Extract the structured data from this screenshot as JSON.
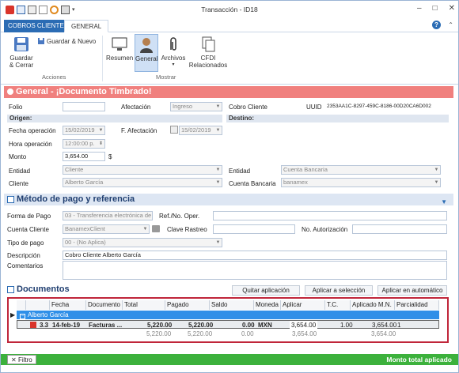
{
  "window": {
    "title": "Transacción - ID18"
  },
  "tabs": {
    "active_tab": "COBROS CLIENTE",
    "general_tab": "GENERAL"
  },
  "ribbon": {
    "guardar_cerrar": "Guardar\n& Cerrar",
    "guardar_nuevo": "Guardar & Nuevo",
    "acciones_group": "Acciones",
    "resumen": "Resumen",
    "general": "General",
    "archivos": "Archivos",
    "cfdi": "CFDI\nRelacionados",
    "mostrar_group": "Mostrar"
  },
  "header": {
    "status_title": "General - ¡Documento Timbrado!"
  },
  "general": {
    "folio_label": "Folio",
    "folio_value": "",
    "afectacion_label": "Afectación",
    "afectacion_value": "Ingreso",
    "cobro_cliente_label": "Cobro Cliente",
    "uuid_label": "UUID",
    "uuid_value": "2353AA1C-8297-459C-8186-00D20CA6D002",
    "origen_label": "Origen:",
    "destino_label": "Destino:",
    "fecha_operacion_label": "Fecha operación",
    "fecha_operacion_value": "15/02/2019",
    "f_afectacion_label": "F. Afectación",
    "f_afectacion_value": "15/02/2019",
    "hora_operacion_label": "Hora operación",
    "hora_operacion_value": "12:00:00 p.",
    "monto_label": "Monto",
    "monto_value": "3,654.00",
    "monto_currency": "$",
    "entidad_label": "Entidad",
    "entidad_value": "Cliente",
    "cliente_label": "Cliente",
    "cliente_value": "Alberto García",
    "entidad_dest_label": "Entidad",
    "entidad_dest_value": "Cuenta Bancaria",
    "cuenta_bancaria_label": "Cuenta Bancaria",
    "cuenta_bancaria_value": "banamex"
  },
  "pago": {
    "section_title": "Método de pago y referencia",
    "forma_pago_label": "Forma de Pago",
    "forma_pago_value": "03 - Transferencia electrónica de",
    "ref_label": "Ref./No. Oper.",
    "ref_value": "",
    "cuenta_cliente_label": "Cuenta Cliente",
    "cuenta_cliente_value": "BanamexClient",
    "clave_rastreo_label": "Clave Rastreo",
    "clave_rastreo_value": "",
    "no_autorizacion_label": "No. Autorización",
    "no_autorizacion_value": "",
    "tipo_pago_label": "Tipo de pago",
    "tipo_pago_value": "00 - (No Aplica)",
    "descripcion_label": "Descripción",
    "descripcion_value": "Cobro Cliente Alberto García",
    "comentarios_label": "Comentarios",
    "comentarios_value": ""
  },
  "documentos": {
    "section_title": "Documentos",
    "quitar": "Quitar aplicación",
    "aplicar_sel": "Aplicar a selección",
    "aplicar_auto": "Aplicar en automático",
    "columns": [
      "Fecha",
      "Documento",
      "Total",
      "Pagado",
      "Saldo",
      "Moneda",
      "Aplicar",
      "T.C.",
      "Aplicado M.N.",
      "Parcialidad"
    ],
    "group_label": "Alberto García",
    "row": {
      "id": "3.3",
      "fecha": "14-feb-19",
      "documento": "Facturas ...",
      "total": "5,220.00",
      "pagado": "5,220.00",
      "saldo": "0.00",
      "moneda": "MXN",
      "aplicar": "3,654.00",
      "tc": "1.00",
      "aplicado_mn": "3,654.00",
      "parcialidad": "1"
    },
    "totals": {
      "total": "5,220.00",
      "pagado": "5,220.00",
      "saldo": "0.00",
      "aplicar": "3,654.00",
      "aplicado_mn": "3,654.00"
    }
  },
  "footer": {
    "filtro": "Filtro",
    "monto_total": "Monto total aplicado"
  }
}
